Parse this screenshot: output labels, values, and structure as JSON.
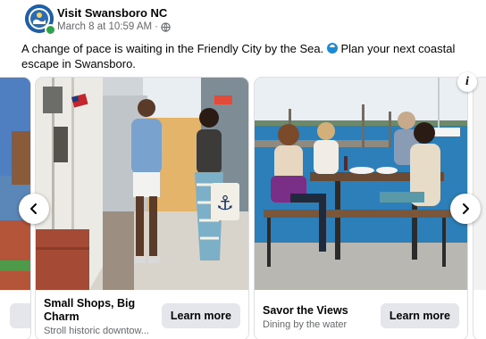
{
  "post": {
    "page_name": "Visit Swansboro NC",
    "timestamp": "March 8 at 10:59 AM",
    "separator": "·",
    "audience_icon": "globe-icon",
    "caption_part1": "A change of pace is waiting in the Friendly City by the Sea.",
    "caption_part2": "Plan your next coastal escape in Swansboro."
  },
  "carousel": {
    "cards": [
      {
        "title": "Small Shops, Big Charm",
        "subtitle": "Stroll historic downtow...",
        "cta": "Learn more"
      },
      {
        "title": "Savor the Views",
        "subtitle": "Dining by the water",
        "cta": "Learn more"
      }
    ],
    "prev_icon": "chevron-left-icon",
    "next_icon": "chevron-right-icon",
    "info_icon": "info-icon",
    "info_glyph": "i"
  },
  "colors": {
    "online": "#31a24c",
    "button_bg": "#e4e6eb",
    "secondary_text": "#65676b"
  }
}
